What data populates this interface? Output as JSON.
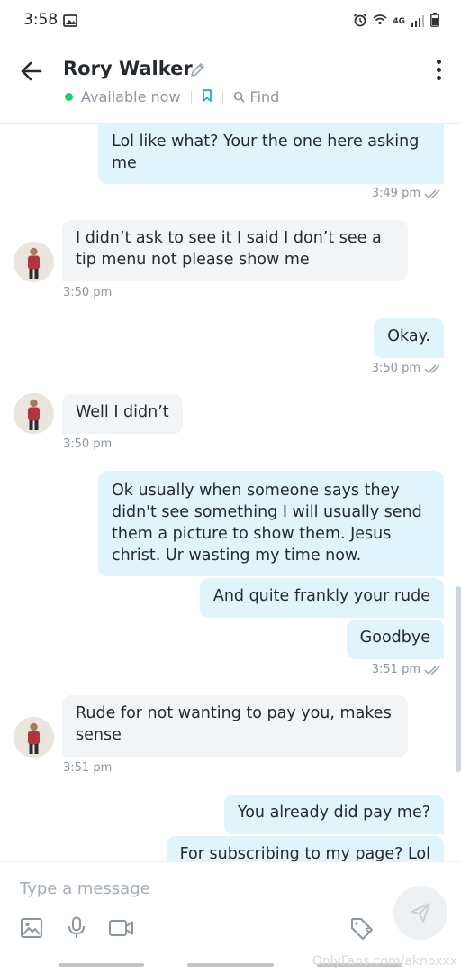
{
  "status_bar": {
    "time": "3:58",
    "network": "4G"
  },
  "header": {
    "contact_name": "Rory Walker",
    "status": "Available now",
    "find_label": "Find"
  },
  "messages": [
    {
      "text": "Lol like what? Your the one here asking me",
      "time": "3:49 pm"
    },
    {
      "text": "I didn’t ask to see it I said I don’t see a tip menu not please show me",
      "time": "3:50 pm"
    },
    {
      "text": "Okay.",
      "time": "3:50 pm"
    },
    {
      "text": "Well I didn’t",
      "time": "3:50 pm"
    },
    {
      "text": "Ok usually when someone says they didn't see something I will usually send them a picture to show them. Jesus christ. Ur wasting my time now."
    },
    {
      "text": "And quite frankly your rude"
    },
    {
      "text": "Goodbye",
      "time": "3:51 pm"
    },
    {
      "text": "Rude for not wanting to pay you, makes sense",
      "time": "3:51 pm"
    },
    {
      "text": "You already did pay me?"
    },
    {
      "text": "For subscribing to my page? Lol"
    }
  ],
  "composer": {
    "placeholder": "Type a message",
    "icons": [
      "image-icon",
      "microphone-icon",
      "video-icon",
      "price-tag-icon",
      "send-icon"
    ]
  },
  "watermark": "OnlyFans.com/aknoxxx",
  "colors": {
    "outgoing_bubble": "#e0f4fc",
    "incoming_bubble": "#f2f4f5",
    "online_dot": "#1fcc6f",
    "accent": "#00aff0"
  }
}
